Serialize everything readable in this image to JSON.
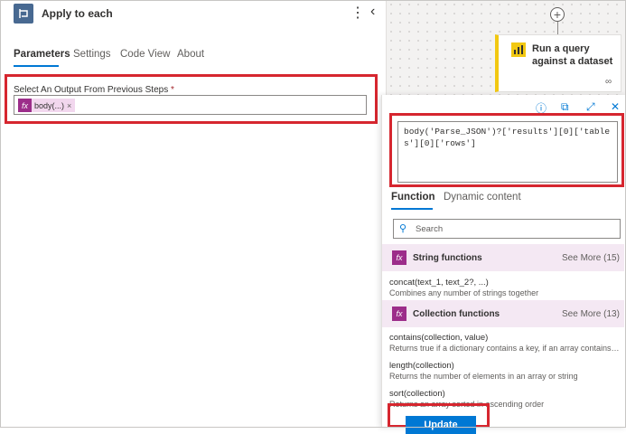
{
  "header": {
    "title": "Apply to each",
    "more_glyph": "⋮",
    "collapse_glyph": "‹"
  },
  "tabs": [
    {
      "label": "Parameters"
    },
    {
      "label": "Settings"
    },
    {
      "label": "Code View"
    },
    {
      "label": "About"
    }
  ],
  "field": {
    "label": "Select An Output From Previous Steps",
    "required_mark": "*",
    "token": {
      "fx": "fx",
      "label": "body(...)",
      "remove": "×"
    }
  },
  "flow": {
    "add_glyph": "+",
    "card_title": "Run a query against a dataset",
    "card_link_glyph": "∞"
  },
  "expression": {
    "icons": {
      "info": "ⓘ",
      "copy": "⧉",
      "expand": "⤢",
      "close": "✕"
    },
    "text": "body('Parse_JSON')?['results'][0]['tables'][0]['rows']",
    "tabs": [
      {
        "label": "Function"
      },
      {
        "label": "Dynamic content"
      }
    ],
    "search_placeholder": "Search",
    "sections": [
      {
        "title": "String functions",
        "see_more": "See More (15)",
        "functions": [
          {
            "name": "concat(text_1, text_2?, ...)",
            "desc": "Combines any number of strings together"
          }
        ]
      },
      {
        "title": "Collection functions",
        "see_more": "See More (13)",
        "functions": [
          {
            "name": "contains(collection, value)",
            "desc": "Returns true if a dictionary contains a key, if an array contains a val..."
          },
          {
            "name": "length(collection)",
            "desc": "Returns the number of elements in an array or string"
          },
          {
            "name": "sort(collection)",
            "desc": "Returns an array sorted in ascending order"
          }
        ]
      }
    ],
    "update_label": "Update"
  },
  "colors": {
    "accent": "#0078d4",
    "highlight_red": "#d6262f",
    "fx_purple": "#9c2d8a",
    "dataset_yellow": "#f2c811"
  }
}
